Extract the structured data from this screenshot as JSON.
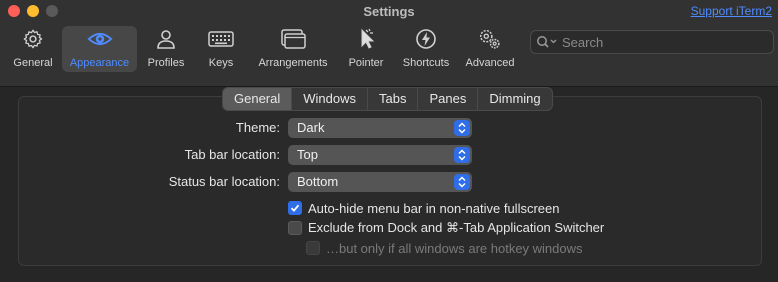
{
  "window": {
    "title": "Settings",
    "support_link": "Support iTerm2"
  },
  "toolbar": {
    "items": [
      {
        "label": "General",
        "icon": "gear-icon"
      },
      {
        "label": "Appearance",
        "icon": "eye-icon",
        "active": true
      },
      {
        "label": "Profiles",
        "icon": "person-icon"
      },
      {
        "label": "Keys",
        "icon": "keyboard-icon"
      },
      {
        "label": "Arrangements",
        "icon": "windows-icon"
      },
      {
        "label": "Pointer",
        "icon": "pointer-icon"
      },
      {
        "label": "Shortcuts",
        "icon": "lightning-icon"
      },
      {
        "label": "Advanced",
        "icon": "gears-icon"
      }
    ],
    "search_placeholder": "Search"
  },
  "tabs": [
    {
      "label": "General",
      "active": true
    },
    {
      "label": "Windows"
    },
    {
      "label": "Tabs"
    },
    {
      "label": "Panes"
    },
    {
      "label": "Dimming"
    }
  ],
  "settings": {
    "theme": {
      "label": "Theme:",
      "value": "Dark"
    },
    "tab_bar_location": {
      "label": "Tab bar location:",
      "value": "Top"
    },
    "status_bar_location": {
      "label": "Status bar location:",
      "value": "Bottom"
    },
    "auto_hide_menu": {
      "label": "Auto-hide menu bar in non-native fullscreen",
      "checked": true
    },
    "exclude_from_dock": {
      "label": "Exclude from Dock and ⌘-Tab Application Switcher",
      "checked": false
    },
    "only_hotkey": {
      "label": "…but only if all windows are hotkey windows",
      "checked": false,
      "disabled": true
    }
  },
  "colors": {
    "accent": "#2f6ee8",
    "link": "#4f8cff",
    "close": "#ff5f57",
    "minimize": "#febc2e"
  }
}
